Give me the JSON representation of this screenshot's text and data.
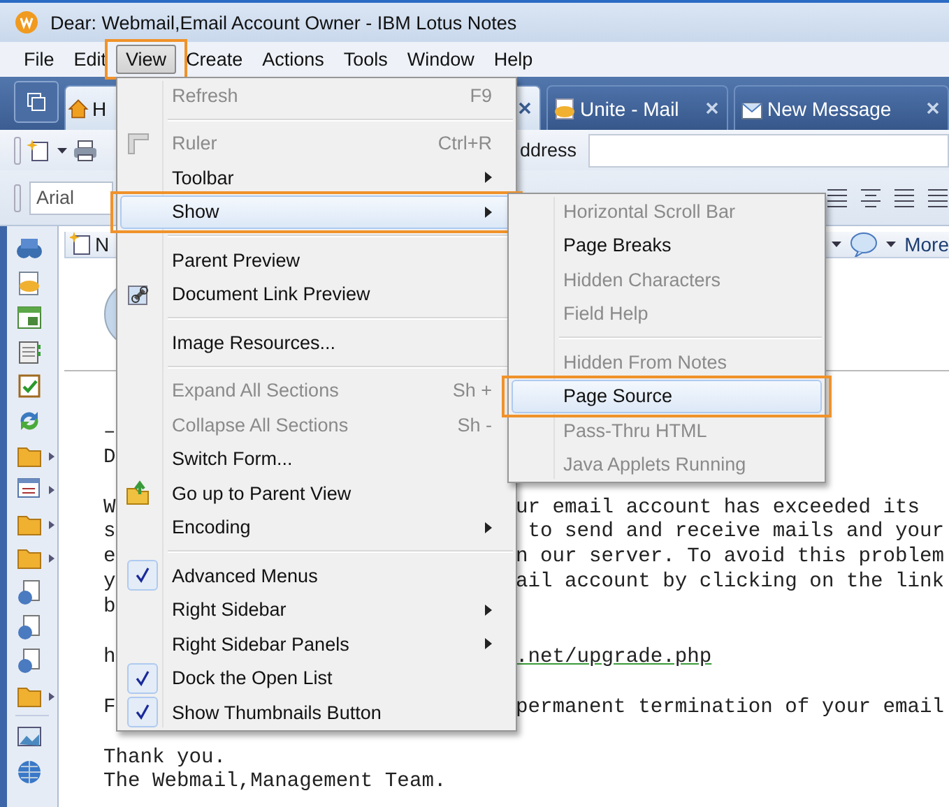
{
  "window": {
    "title": "Dear: Webmail,Email Account Owner - IBM Lotus Notes"
  },
  "menubar": [
    {
      "label": "File",
      "selected": false,
      "annotated": false
    },
    {
      "label": "Edit",
      "selected": false,
      "annotated": false
    },
    {
      "label": "View",
      "selected": true,
      "annotated": true
    },
    {
      "label": "Create",
      "selected": false,
      "annotated": false
    },
    {
      "label": "Actions",
      "selected": false,
      "annotated": false
    },
    {
      "label": "Tools",
      "selected": false,
      "annotated": false
    },
    {
      "label": "Window",
      "selected": false,
      "annotated": false
    },
    {
      "label": "Help",
      "selected": false,
      "annotated": false
    }
  ],
  "tabs": [
    {
      "label": "H",
      "kind": "home",
      "selected": false
    },
    {
      "kind": "document",
      "selected": true,
      "closable": true
    },
    {
      "label": "Unite - Mail",
      "kind": "mail",
      "selected": false,
      "closable": true
    },
    {
      "label": "New Message",
      "kind": "message",
      "selected": false,
      "closable": true
    }
  ],
  "toolbar": {
    "address_label": "ddress",
    "font_field": "Arial"
  },
  "content_toolbar": {
    "new_label": "N",
    "more_label": "More"
  },
  "body": [
    [
      {
        "left": "–"
      },
      {
        "left": "D"
      }
    ],
    [
      {
        "left": "W",
        "right": "ur email account has exceeded its"
      },
      {
        "left": "s",
        "right": " to send and receive mails and your"
      },
      {
        "left": "e",
        "right": "n our server. To avoid this problem"
      },
      {
        "left": "y",
        "right": "ail account by clicking on the link"
      },
      {
        "left": "b"
      }
    ],
    [
      {
        "left": "h",
        "right": ".net/upgrade.php",
        "link": true
      }
    ],
    [
      {
        "left": "F",
        "right": "permanent termination of your email"
      }
    ],
    [
      {
        "left": "Thank you."
      },
      {
        "left": "The Webmail,Management Team."
      }
    ]
  ],
  "view_menu": [
    [
      {
        "label": "Refresh",
        "shortcut": "F9",
        "disabled": true
      }
    ],
    [
      {
        "label": "Ruler",
        "shortcut": "Ctrl+R",
        "disabled": true,
        "icon": true
      },
      {
        "label": "Toolbar",
        "submenu": true
      },
      {
        "label": "Show",
        "submenu": true,
        "selected": true,
        "annotated": true
      }
    ],
    [
      {
        "label": "Parent Preview"
      },
      {
        "label": "Document Link Preview",
        "icon": true
      }
    ],
    [
      {
        "label": "Image Resources..."
      }
    ],
    [
      {
        "label": "Expand All Sections",
        "shortcut": "Sh +",
        "disabled": true
      },
      {
        "label": "Collapse All Sections",
        "shortcut": "Sh -",
        "disabled": true
      },
      {
        "label": "Switch Form..."
      },
      {
        "label": "Go up to Parent View",
        "icon": true
      },
      {
        "label": "Encoding",
        "submenu": true
      }
    ],
    [
      {
        "label": "Advanced Menus",
        "checked": true
      },
      {
        "label": "Right Sidebar",
        "submenu": true
      },
      {
        "label": "Right Sidebar Panels",
        "submenu": true
      },
      {
        "label": "Dock the Open List",
        "checked": true
      },
      {
        "label": "Show Thumbnails Button",
        "checked": true
      }
    ]
  ],
  "show_submenu": [
    [
      {
        "label": "Horizontal Scroll Bar",
        "disabled": true
      },
      {
        "label": "Page Breaks",
        "disabled": false
      },
      {
        "label": "Hidden Characters",
        "disabled": true
      },
      {
        "label": "Field Help",
        "disabled": true
      }
    ],
    [
      {
        "label": "Hidden From Notes",
        "disabled": true
      },
      {
        "label": "Page Source",
        "disabled": false,
        "selected": true,
        "annotated": true
      },
      {
        "label": "Pass-Thru HTML",
        "disabled": true
      },
      {
        "label": "Java Applets Running",
        "disabled": true
      }
    ]
  ]
}
